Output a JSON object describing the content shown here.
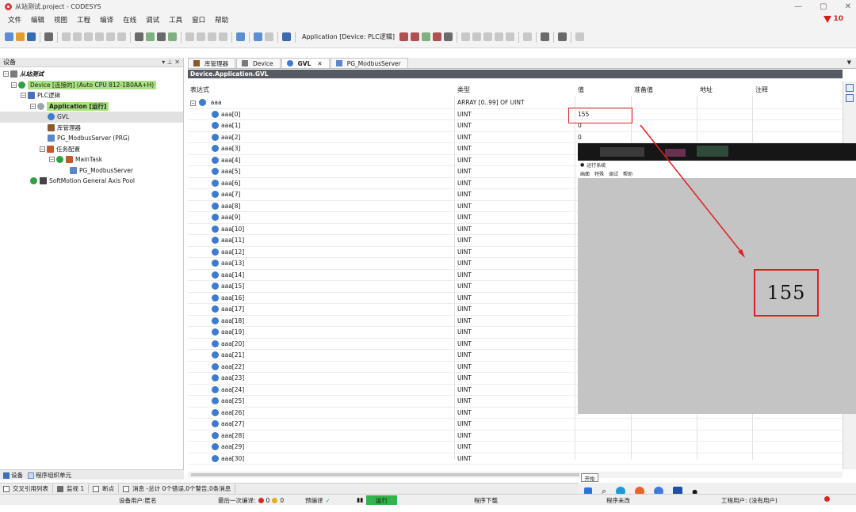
{
  "window": {
    "title": "从站测试.project - CODESYS",
    "minimize": "—",
    "maximize": "▢",
    "close": "✕"
  },
  "menu": [
    "文件",
    "编辑",
    "视图",
    "工程",
    "编译",
    "在线",
    "调试",
    "工具",
    "窗口",
    "帮助"
  ],
  "flag_count": "10",
  "toolbar": {
    "application_label": "Application [Device: PLC逻辑]"
  },
  "device_panel": {
    "title": "设备",
    "pins": "▾ ⊥ ✕",
    "tree": {
      "project": "从站测试",
      "device": "Device [连接的] (Auto CPU 812-1B0AA+H)",
      "plc": "PLC逻辑",
      "application": "Application [运行]",
      "gvl": "GVL",
      "library": "库管理器",
      "prg": "PG_ModbusServer (PRG)",
      "task_config": "任务配置",
      "main_task": "MainTask",
      "task_prg": "PG_ModbusServer",
      "softmotion": "SoftMotion General Axis Pool"
    },
    "footer_devices": "设备",
    "footer_pou": "程序组织单元"
  },
  "tabs": [
    {
      "label": "库管理器"
    },
    {
      "label": "Device"
    },
    {
      "label": "GVL",
      "close": "✕"
    },
    {
      "label": "PG_ModbusServer"
    }
  ],
  "editor": {
    "path": "Device.Application.GVL",
    "headers": {
      "expression": "表达式",
      "type": "类型",
      "value": "值",
      "prepared": "准备值",
      "address": "地址",
      "comment": "注释"
    },
    "array": {
      "name": "aaa",
      "type": "ARRAY [0..99] OF UINT"
    },
    "rows": [
      {
        "name": "aaa[0]",
        "type": "UINT",
        "value": "155"
      },
      {
        "name": "aaa[1]",
        "type": "UINT",
        "value": "0"
      },
      {
        "name": "aaa[2]",
        "type": "UINT",
        "value": "0"
      },
      {
        "name": "aaa[3]",
        "type": "UINT",
        "value": ""
      },
      {
        "name": "aaa[4]",
        "type": "UINT",
        "value": ""
      },
      {
        "name": "aaa[5]",
        "type": "UINT",
        "value": ""
      },
      {
        "name": "aaa[6]",
        "type": "UINT",
        "value": ""
      },
      {
        "name": "aaa[7]",
        "type": "UINT",
        "value": ""
      },
      {
        "name": "aaa[8]",
        "type": "UINT",
        "value": ""
      },
      {
        "name": "aaa[9]",
        "type": "UINT",
        "value": ""
      },
      {
        "name": "aaa[10]",
        "type": "UINT",
        "value": ""
      },
      {
        "name": "aaa[11]",
        "type": "UINT",
        "value": ""
      },
      {
        "name": "aaa[12]",
        "type": "UINT",
        "value": ""
      },
      {
        "name": "aaa[13]",
        "type": "UINT",
        "value": ""
      },
      {
        "name": "aaa[14]",
        "type": "UINT",
        "value": ""
      },
      {
        "name": "aaa[15]",
        "type": "UINT",
        "value": ""
      },
      {
        "name": "aaa[16]",
        "type": "UINT",
        "value": ""
      },
      {
        "name": "aaa[17]",
        "type": "UINT",
        "value": ""
      },
      {
        "name": "aaa[18]",
        "type": "UINT",
        "value": ""
      },
      {
        "name": "aaa[19]",
        "type": "UINT",
        "value": ""
      },
      {
        "name": "aaa[20]",
        "type": "UINT",
        "value": ""
      },
      {
        "name": "aaa[21]",
        "type": "UINT",
        "value": ""
      },
      {
        "name": "aaa[22]",
        "type": "UINT",
        "value": ""
      },
      {
        "name": "aaa[23]",
        "type": "UINT",
        "value": ""
      },
      {
        "name": "aaa[24]",
        "type": "UINT",
        "value": ""
      },
      {
        "name": "aaa[25]",
        "type": "UINT",
        "value": ""
      },
      {
        "name": "aaa[26]",
        "type": "UINT",
        "value": ""
      },
      {
        "name": "aaa[27]",
        "type": "UINT",
        "value": ""
      },
      {
        "name": "aaa[28]",
        "type": "UINT",
        "value": ""
      },
      {
        "name": "aaa[29]",
        "type": "UINT",
        "value": ""
      },
      {
        "name": "aaa[30]",
        "type": "UINT",
        "value": ""
      }
    ]
  },
  "runtime_window": {
    "title": "运行系统",
    "menu": [
      "画面",
      "特殊",
      "调试",
      "帮助"
    ],
    "value": "155",
    "start": "开始"
  },
  "message_bar": {
    "cross_ref": "交叉引用列表",
    "watch": "监视 1",
    "breakpoints": "断点",
    "messages": "消息 -总计 0个错误,0个警告,0条消息"
  },
  "status": {
    "device_user": "设备用户:匿名",
    "last_compile": "最后一次编译:",
    "errors": "0",
    "warnings": "0",
    "precompile": "预编译",
    "precompile_ok": "✓",
    "running": "运行",
    "download": "程序下载",
    "program_unchanged": "程序未改",
    "project_user": "工程用户: (没有用户)"
  },
  "colors": {
    "accent_red": "#e02020",
    "run_green": "#34b34a",
    "tree_green": "#a9e37f"
  }
}
